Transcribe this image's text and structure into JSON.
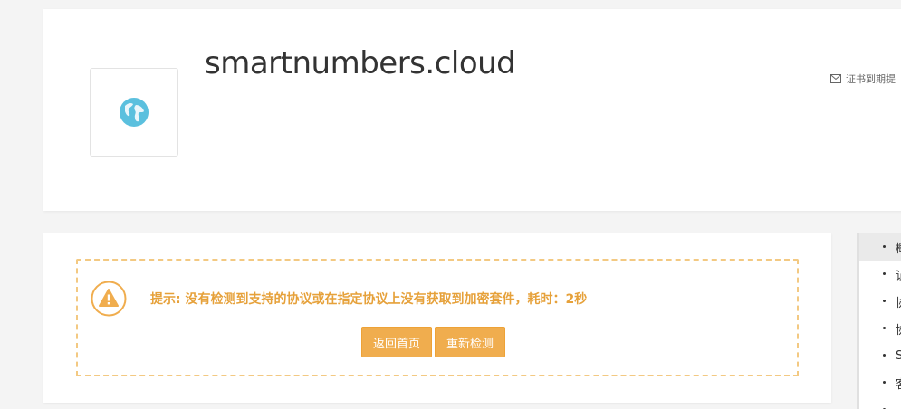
{
  "header": {
    "domain": "smartnumbers.cloud",
    "site_icon": "globe-icon",
    "cert_reminder_icon": "envelope-icon",
    "cert_reminder_label": "证书到期提"
  },
  "notice": {
    "icon": "warning-icon",
    "accent_color": "#f0ad4e",
    "message": "提示: 没有检测到支持的协议或在指定协议上没有获取到加密套件，耗时：2秒",
    "buttons": {
      "home_label": "返回首页",
      "recheck_label": "重新检测"
    }
  },
  "side_nav": {
    "items": [
      {
        "label": "概"
      },
      {
        "label": "证"
      },
      {
        "label": "协"
      },
      {
        "label": "协"
      },
      {
        "label": "S"
      },
      {
        "label": "客"
      },
      {
        "label": ""
      }
    ]
  }
}
